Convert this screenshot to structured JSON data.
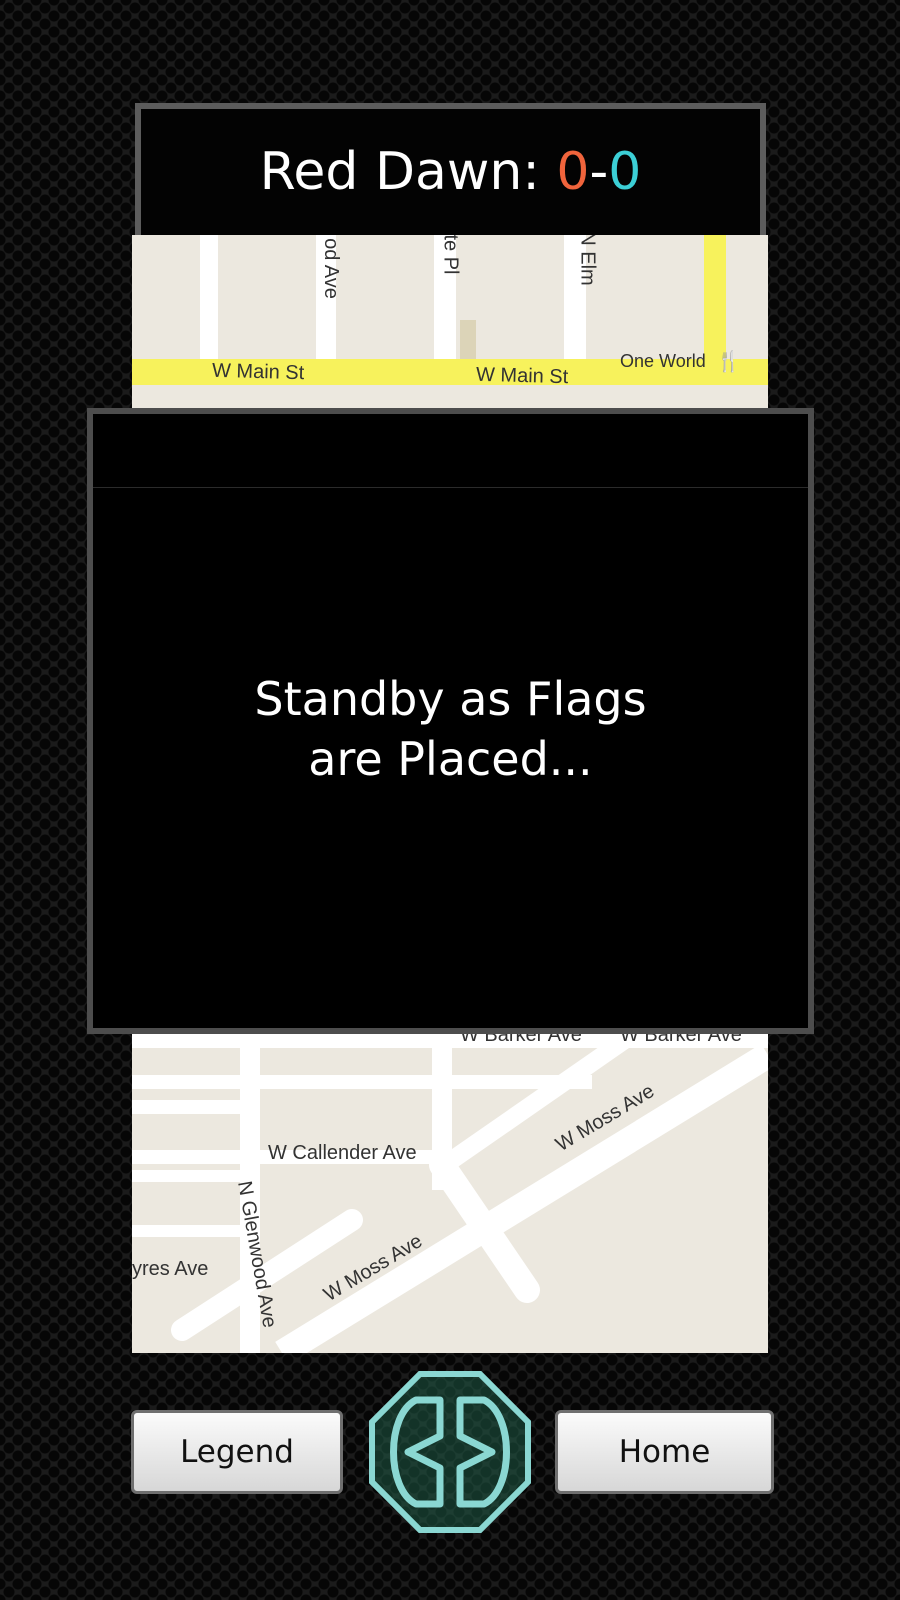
{
  "header": {
    "team_name": "Red Dawn:",
    "red_score": "0",
    "separator": "-",
    "blue_score": "0"
  },
  "map": {
    "streets": {
      "w_main_st_left": "W Main St",
      "w_main_st_right": "W Main St",
      "one_world": "One World",
      "od_ave": "od Ave",
      "te_pl": "te Pl",
      "n_elm": "N Elm",
      "w_barker_ave_left": "W Barker Ave",
      "w_barker_ave_right": "W Barker Ave",
      "w_callender_ave": "W Callender Ave",
      "w_moss_ave_upper": "W Moss Ave",
      "w_moss_ave_lower": "W Moss Ave",
      "n_glenwood_ave": "N Glenwood Ave",
      "yres_ave": "yres Ave"
    }
  },
  "dialog": {
    "message": "Standby as Flags\nare Placed..."
  },
  "footer": {
    "legend_label": "Legend",
    "home_label": "Home",
    "logo_icon": "game-logo-icon"
  },
  "colors": {
    "red_team": "#f0643c",
    "blue_team": "#3ccfd6",
    "logo": "#8ad7d2"
  }
}
